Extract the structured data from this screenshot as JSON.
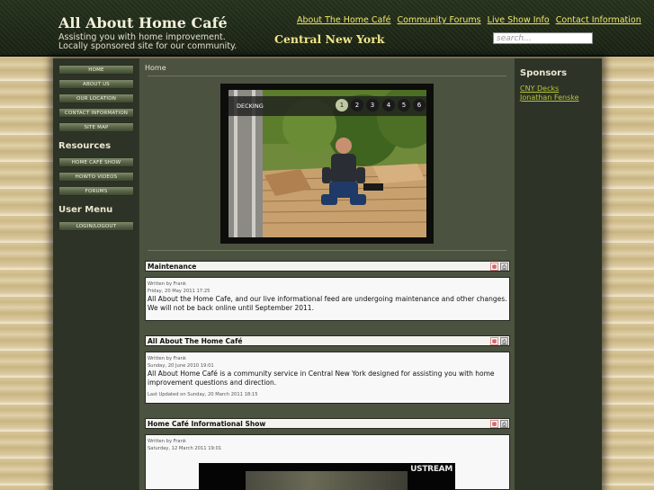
{
  "header": {
    "site_title": "All About Home Café",
    "tagline_line1": "Assisting you with home improvement.",
    "tagline_line2": "Locally sponsored site for our community.",
    "region": "Central New York",
    "nav": [
      "About The Home Café",
      "Community Forums",
      "Live Show Info",
      "Contact Information"
    ],
    "search_placeholder": "search..."
  },
  "main_menu": [
    "HOME",
    "ABOUT US",
    "OUR LOCATION",
    "CONTACT INFORMATION",
    "SITE MAP"
  ],
  "resources": {
    "heading": "Resources",
    "items": [
      "HOME CAFÉ SHOW",
      "HOWTO VIDEOS",
      "FORUMS"
    ]
  },
  "user_menu": {
    "heading": "User Menu",
    "items": [
      "LOGIN/LOGOUT"
    ]
  },
  "breadcrumb": "Home",
  "slideshow": {
    "label": "DECKING",
    "dots": [
      "1",
      "2",
      "3",
      "4",
      "5",
      "6"
    ],
    "active": "1"
  },
  "articles": [
    {
      "title": "Maintenance",
      "author": "Written by Frank",
      "date": "Friday, 20 May 2011 17:25",
      "text": "All About the Home Cafe, and our live informational feed are undergoing maintenance and other changes. We will not be back online until September 2011."
    },
    {
      "title": "All About The Home Café",
      "author": "Written by Frank",
      "date": "Sunday, 20 June 2010 19:01",
      "text": "All About Home Café is a community service in Central New York designed for assisting you with home improvement questions and direction.",
      "updated": "Last Updated on Sunday, 20 March 2011 18:15"
    },
    {
      "title": "Home Café Informational Show",
      "author": "Written by Frank",
      "date": "Saturday, 12 March 2011 19:01"
    }
  ],
  "video": {
    "brand": "USTREAM"
  },
  "sponsors": {
    "heading": "Sponsors",
    "items": [
      "CNY Decks",
      "Jonathan Fenske"
    ]
  },
  "icons": {
    "pdf": "pdf-icon",
    "print": "print-icon"
  },
  "colors": {
    "link_yellow": "#f2e86a",
    "sponsor_link": "#b8c23a",
    "header_bg": "#1f2818"
  }
}
